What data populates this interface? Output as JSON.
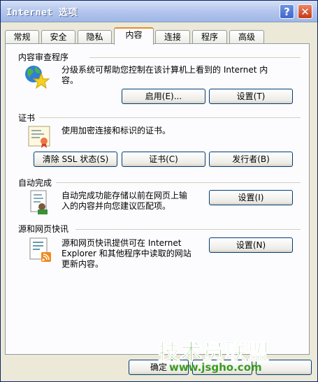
{
  "window": {
    "title": "Internet 选项",
    "help_label": "?",
    "close_label": "✕"
  },
  "tabs": [
    {
      "label": "常规"
    },
    {
      "label": "安全"
    },
    {
      "label": "隐私"
    },
    {
      "label": "内容"
    },
    {
      "label": "连接"
    },
    {
      "label": "程序"
    },
    {
      "label": "高级"
    }
  ],
  "active_tab": "内容",
  "content_advisor": {
    "title": "内容审查程序",
    "desc_line1": "分级系统可帮助您控制在该计算机上看到的 Internet 内",
    "desc_line2": "容。",
    "enable_label": "启用(E)...",
    "settings_label": "设置(T)"
  },
  "certificates": {
    "title": "证书",
    "desc": "使用加密连接和标识的证书。",
    "clear_ssl_label": "清除 SSL 状态(S)",
    "certs_label": "证书(C)",
    "publishers_label": "发行者(B)"
  },
  "autocomplete": {
    "title": "自动完成",
    "desc_line1": "自动完成功能存储以前在网页上输",
    "desc_line2": "入的内容并向您建议匹配项。",
    "settings_label": "设置(I)"
  },
  "feeds": {
    "title": "源和网页快讯",
    "desc_line1": "源和网页快讯提供可在 Internet",
    "desc_line2": "Explorer 和其他程序中读取的网站",
    "desc_line3": "更新内容。",
    "settings_label": "设置(N)"
  },
  "footer": {
    "ok_label": "确定"
  },
  "watermark": {
    "text_cn": "技术员联盟",
    "url": "www.jsgho.com"
  }
}
